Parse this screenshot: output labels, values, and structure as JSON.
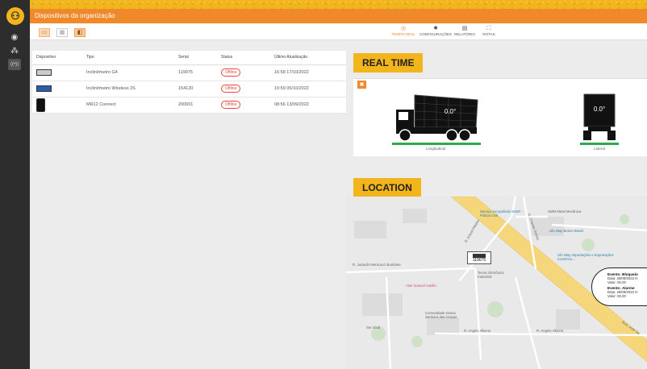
{
  "app": {
    "header_title": "Dispositivos da organização"
  },
  "sidebar": {
    "logo": "person-icon",
    "items": [
      {
        "name": "globe-icon",
        "glyph": "◉"
      },
      {
        "name": "network-icon",
        "glyph": "⁂"
      },
      {
        "name": "signal-icon",
        "glyph": "((•))"
      }
    ]
  },
  "view_buttons": [
    {
      "name": "list-view",
      "glyph": "▭"
    },
    {
      "name": "grid-view",
      "glyph": "▦"
    },
    {
      "name": "detail-view",
      "glyph": "◧"
    }
  ],
  "tabs": [
    {
      "label": "TEMPO REAL",
      "icon": "clock-icon",
      "glyph": "◎"
    },
    {
      "label": "CONFIGURAÇÕES",
      "icon": "gear-icon",
      "glyph": "✹"
    },
    {
      "label": "RELATÓRIO",
      "icon": "document-icon",
      "glyph": "▤"
    },
    {
      "label": "ROTAS",
      "icon": "route-icon",
      "glyph": "⛶"
    }
  ],
  "table": {
    "headers": [
      "Dispositivo",
      "Tipo",
      "Serial",
      "Status",
      "Último Atualização"
    ],
    "rows": [
      {
        "device_image": "inclinometer-g4-image",
        "type": "Inclinômetro G4",
        "serial": "119075",
        "status": "Offline",
        "updated": "16:58 17/10/2022"
      },
      {
        "device_image": "inclinometer-wireless-image",
        "type": "Inclinômetro Wireless 2S",
        "serial": "154120",
        "status": "Offline",
        "updated": "10:59 05/10/2022"
      },
      {
        "device_image": "mr12-connect-image",
        "type": "MR12 Connect",
        "serial": "200001",
        "status": "Offline",
        "updated": "08:56 13/09/2022"
      }
    ]
  },
  "real_time": {
    "heading": "REAL TIME",
    "longitudinal": {
      "value": "0.0°",
      "caption": "Longitudinal"
    },
    "lateral": {
      "value": "0.0°",
      "caption": "Lateral"
    }
  },
  "location": {
    "heading": "LOCATION",
    "marker_serial": "119075",
    "places": [
      {
        "label": "Serviço Aeropolicial SAER - Polícia Civil",
        "style": "blue"
      },
      {
        "label": "SMM Metal Mecânica",
        "style": "plain"
      },
      {
        "label": "Ufo Way Bence Brasil",
        "style": "blue"
      },
      {
        "label": "Ufo Way Importações e Exportações Comércio...",
        "style": "blue"
      },
      {
        "label": "Tecnic Eletrônica Industrial",
        "style": "plain"
      },
      {
        "label": "Aleir manuel marillo",
        "style": "pink"
      },
      {
        "label": "Comunidade Nossa Senhora das Graças",
        "style": "plain"
      },
      {
        "label": "Ser Sical",
        "style": "plain"
      }
    ],
    "streets": [
      "R. Jurandir Menicucci Bonfante",
      "R. Angelo Alberto",
      "R. Angelo Alberto",
      "R. Antoni Ribeiro",
      "R. Orlando Veloso",
      "Rod. José Sa"
    ],
    "events": [
      {
        "title": "Evento: Bloqueio",
        "date": "Data: 29/09/2022 H",
        "value": "Valor: 00,00"
      },
      {
        "title": "Evento: Alarme",
        "date": "Data: 29/09/2022 H",
        "value": "Valor: 00,00"
      }
    ]
  }
}
